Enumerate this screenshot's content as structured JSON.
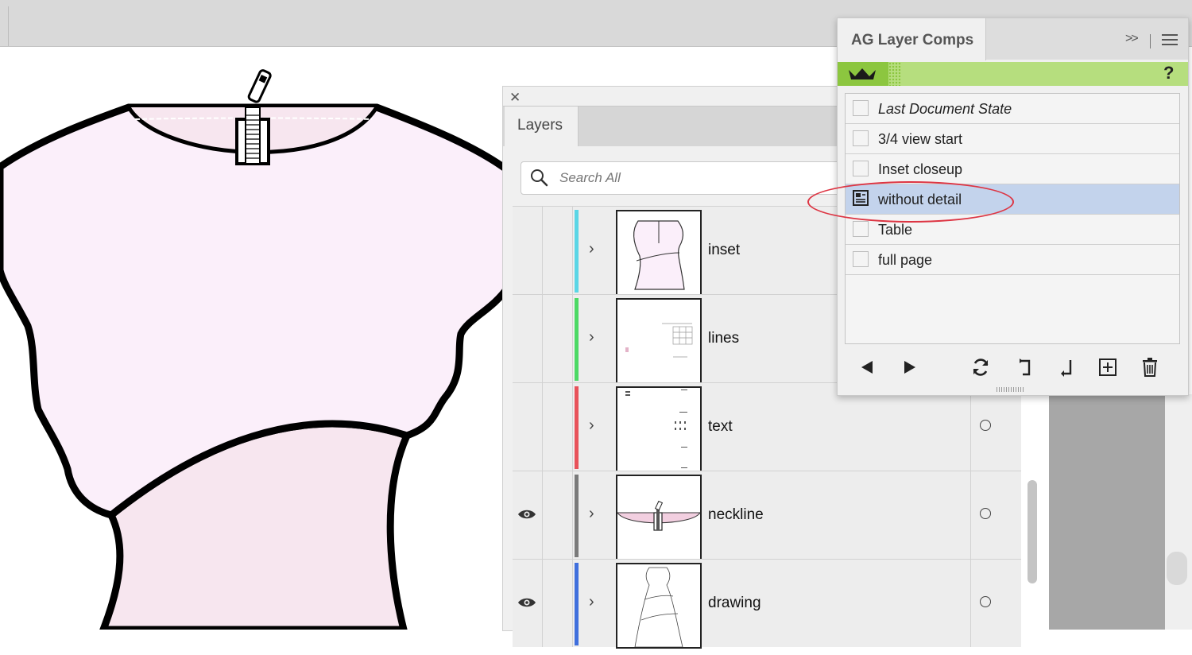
{
  "layers_panel": {
    "tab_label": "Layers",
    "close_glyph": "✕",
    "search": {
      "placeholder": "Search All",
      "icon": "search-icon"
    },
    "expand_glyph": "›",
    "rows": [
      {
        "name": "inset",
        "color": "#5ad6e6",
        "visible": false
      },
      {
        "name": "lines",
        "color": "#4cd964",
        "visible": false
      },
      {
        "name": "text",
        "color": "#e8525a",
        "visible": false
      },
      {
        "name": "neckline",
        "color": "#7a7a7a",
        "visible": true
      },
      {
        "name": "drawing",
        "color": "#3f6fdd",
        "visible": true
      }
    ]
  },
  "comps_panel": {
    "tab_label": "AG Layer Comps",
    "collapse_glyph": ">>",
    "help_glyph": "?",
    "items": [
      {
        "label": "Last Document State",
        "italic": true,
        "selected": false
      },
      {
        "label": "3/4 view start",
        "italic": false,
        "selected": false
      },
      {
        "label": "Inset closeup",
        "italic": false,
        "selected": false
      },
      {
        "label": "without detail",
        "italic": false,
        "selected": true
      },
      {
        "label": "Table",
        "italic": false,
        "selected": false
      },
      {
        "label": "full page",
        "italic": false,
        "selected": false
      }
    ],
    "toolbar": [
      "previous-icon",
      "next-icon",
      "refresh-icon",
      "apply-in-icon",
      "apply-out-icon",
      "new-comp-icon",
      "trash-icon"
    ]
  },
  "colors": {
    "garment_fill": "#fbeffa",
    "skirt_fill": "#f7e6ef",
    "banner_green": "#b6de7e",
    "selection_blue": "#c3d3ec",
    "highlight_red": "#dd3543"
  }
}
